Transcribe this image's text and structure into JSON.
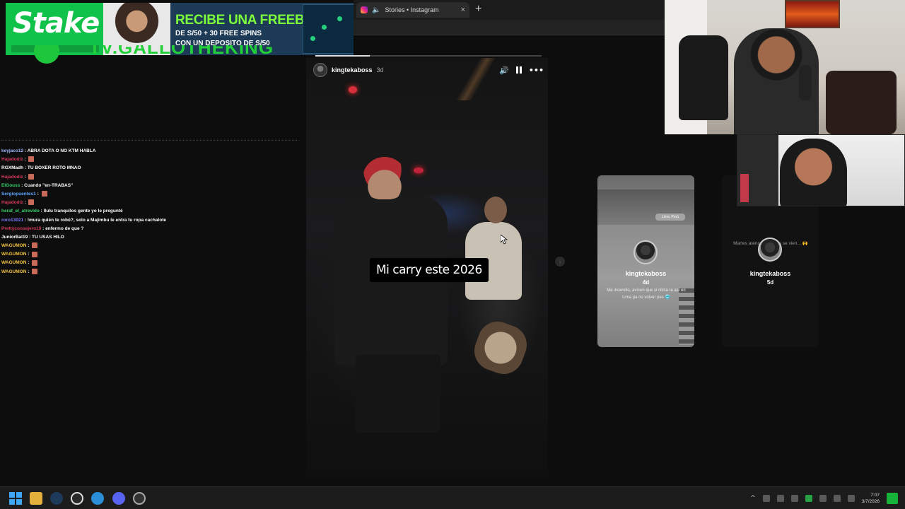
{
  "browser": {
    "tab_title": "Stories • Instagram",
    "tab_close": "×",
    "new_tab": "+",
    "speaker_icon": "🔈"
  },
  "banner": {
    "logo": "Stake",
    "headline": "RECIBE UNA FREEBET",
    "line2": "DE S/50 + 30 FREE SPINS",
    "line3": "CON UN DEPOSITO DE S/50",
    "brand_color": "#11c24a",
    "headline_color": "#7cff3a"
  },
  "overlay_title": "TV.GALLOTHEKING",
  "chat": {
    "messages": [
      {
        "user": "keyjaco12",
        "color": "#9fb7ff",
        "text": "ABRA DOTA O NO KTM HABLA",
        "emote": false
      },
      {
        "user": "Hajadodiz",
        "color": "#d3395a",
        "text": "",
        "emote": true
      },
      {
        "user": "RGXMadh",
        "color": "#ffffff",
        "text": "TU BOXER ROTO MNAO",
        "emote": false
      },
      {
        "user": "Hajadodiz",
        "color": "#d3395a",
        "text": "",
        "emote": true
      },
      {
        "user": "ElGouss",
        "color": "#39d36b",
        "text": "Cuando \"en-TRABAS\"",
        "emote": false
      },
      {
        "user": "Sergiopuentes1",
        "color": "#5aa8ff",
        "text": "",
        "emote": true
      },
      {
        "user": "Hajadodiz",
        "color": "#d3395a",
        "text": "",
        "emote": true
      },
      {
        "user": "heraf_el_atrevido",
        "color": "#39d36b",
        "text": "llulu tranquilos gente yo le pregunté",
        "emote": false
      },
      {
        "user": "roro13021",
        "color": "#7a7aff",
        "text": "!mura quién te robó?, solo a Majimbu le entra tu ropa cachalote",
        "emote": false
      },
      {
        "user": "Prettyconsejero19",
        "color": "#d3395a",
        "text": "enfermo de que ?",
        "emote": false
      },
      {
        "user": "JuniorBal19",
        "color": "#ffffff",
        "text": "TU USAS HILO",
        "emote": false
      },
      {
        "user": "WAGUMON",
        "color": "#f0c040",
        "text": "",
        "emote": true
      },
      {
        "user": "WAGUMON",
        "color": "#f0c040",
        "text": "",
        "emote": true
      },
      {
        "user": "WAGUMON",
        "color": "#f0c040",
        "text": "",
        "emote": true
      },
      {
        "user": "WAGUMON",
        "color": "#f0c040",
        "text": "",
        "emote": true
      }
    ]
  },
  "story": {
    "username": "kingtekaboss",
    "age": "3d",
    "caption": "Mi carry este 2026",
    "progress": 0.24,
    "more_icon": "•••"
  },
  "preview_cards": [
    {
      "username": "kingtekaboss",
      "age": "4d",
      "chip": "Lima, Perú",
      "text": "Me incendio, avícen que si clima ta así en Lima pa no volver pes 🥶"
    },
    {
      "username": "kingtekaboss",
      "age": "5d",
      "chip": "",
      "text": "Martes atenc... ahora si se vien... 🙌"
    }
  ],
  "taskbar": {
    "time": "7:07",
    "date": "3/7/2026"
  }
}
